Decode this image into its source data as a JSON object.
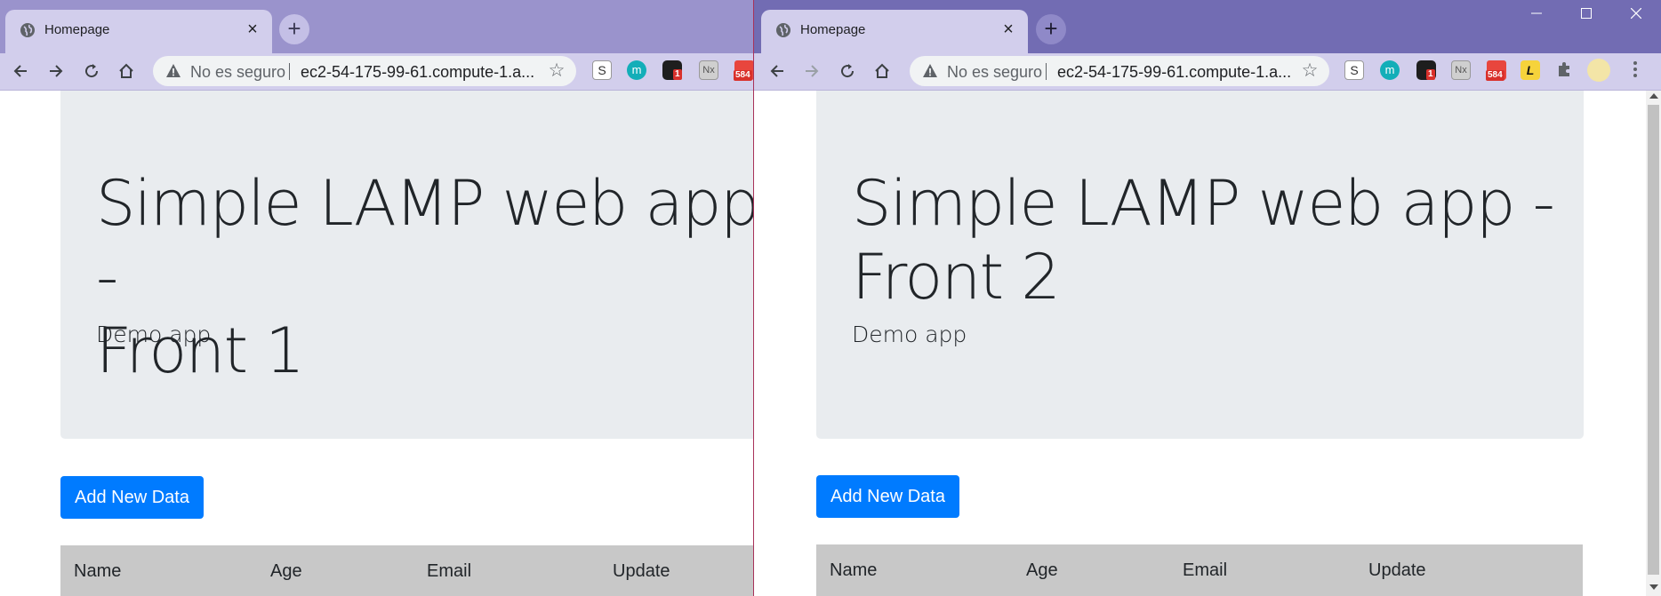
{
  "windows": [
    {
      "tab_title": "Homepage",
      "omnibox": {
        "security_label": "No es seguro",
        "url": "ec2-54-175-99-61.compute-1.a..."
      },
      "extensions": [
        {
          "icon": "s-extension-icon",
          "label": "S"
        },
        {
          "icon": "m-extension-icon",
          "label": "m"
        },
        {
          "icon": "dark-extension-icon",
          "badge": "1"
        },
        {
          "icon": "nx-extension-icon",
          "label": "Nx"
        },
        {
          "icon": "mail-extension-icon",
          "badge": "584"
        }
      ],
      "page": {
        "title": "Simple LAMP web app -\nFront 1",
        "lead": "Demo app",
        "add_button": "Add New Data",
        "table_headers": [
          "Name",
          "Age",
          "Email",
          "Update"
        ]
      }
    },
    {
      "tab_title": "Homepage",
      "omnibox": {
        "security_label": "No es seguro",
        "url": "ec2-54-175-99-61.compute-1.a..."
      },
      "extensions": [
        {
          "icon": "s-extension-icon",
          "label": "S"
        },
        {
          "icon": "m-extension-icon",
          "label": "m"
        },
        {
          "icon": "dark-extension-icon",
          "badge": "1"
        },
        {
          "icon": "nx-extension-icon",
          "label": "Nx"
        },
        {
          "icon": "mail-extension-icon",
          "badge": "584"
        },
        {
          "icon": "l-extension-icon",
          "label": "L"
        },
        {
          "icon": "puzzle-extensions-icon"
        },
        {
          "icon": "profile-avatar-icon"
        },
        {
          "icon": "kebab-menu-icon"
        }
      ],
      "page": {
        "title": "Simple LAMP web app -\nFront 2",
        "lead": "Demo app",
        "add_button": "Add New Data",
        "table_headers": [
          "Name",
          "Age",
          "Email",
          "Update"
        ]
      }
    }
  ],
  "colors": {
    "primary_button": "#007bff",
    "jumbotron_bg": "#e9ecef",
    "table_header_bg": "#c8c8c8",
    "titlebar_left": "#9a93cc",
    "titlebar_right": "#726cb3",
    "tab_active": "#d2ceec"
  }
}
